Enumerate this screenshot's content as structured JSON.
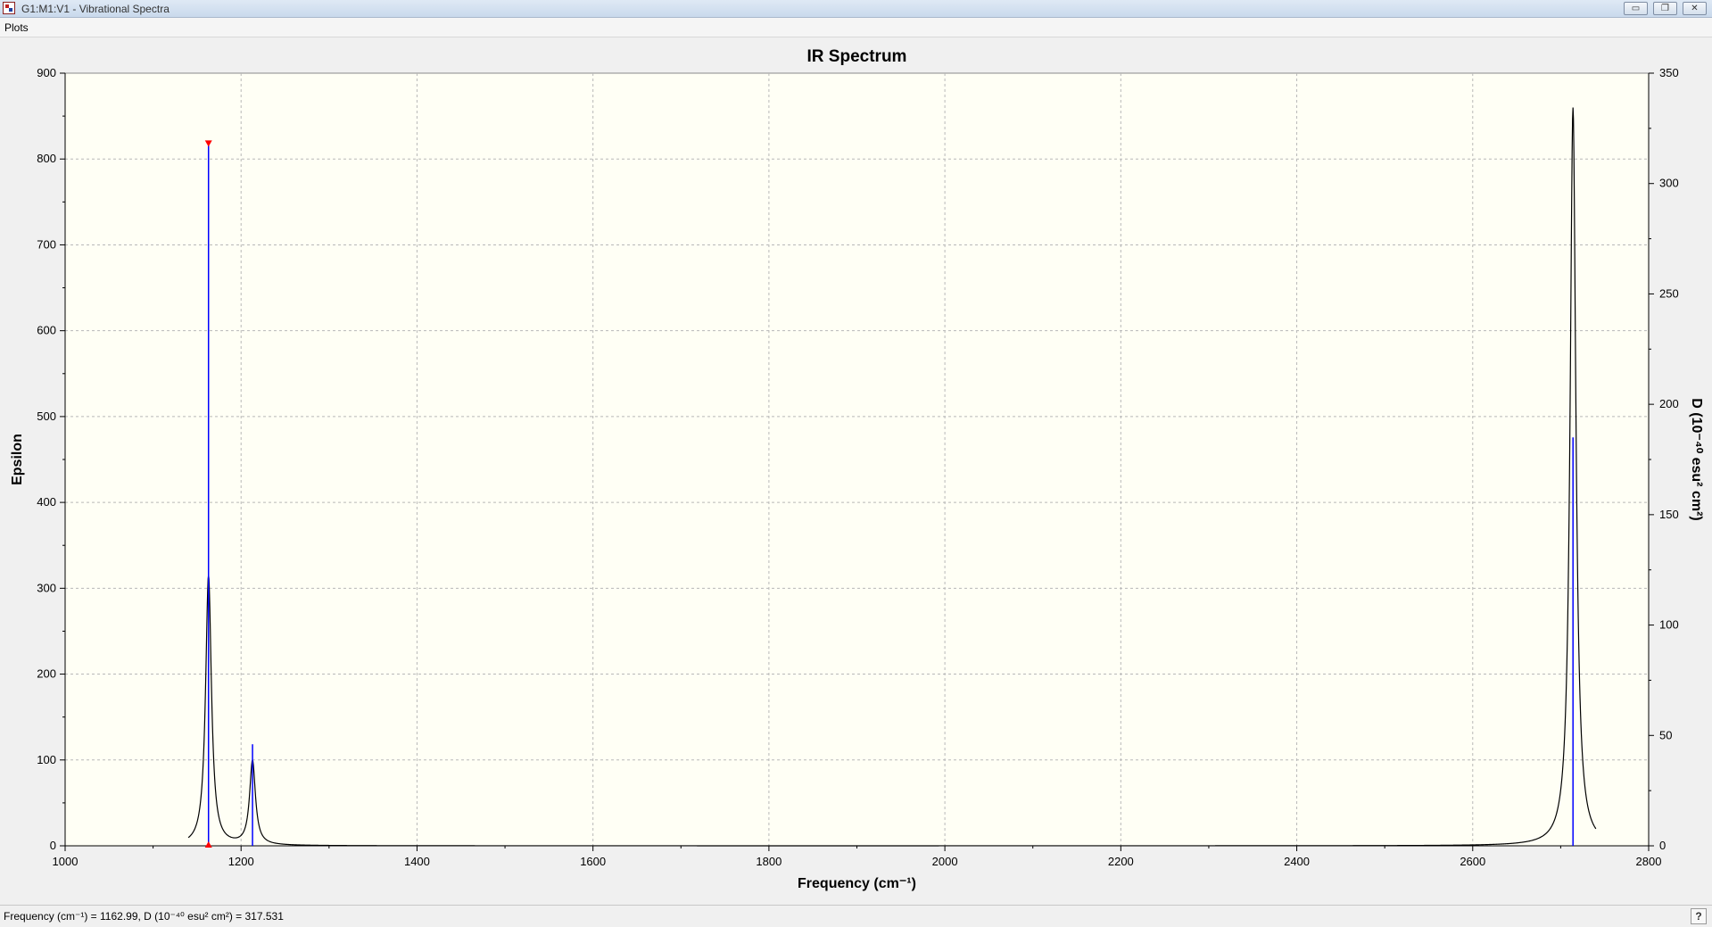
{
  "window": {
    "title": "G1:M1:V1 - Vibrational Spectra",
    "minimize_label": "▭",
    "restore_label": "❐",
    "close_label": "✕"
  },
  "menu": {
    "plots_label": "Plots"
  },
  "status": {
    "readout": "Frequency (cm⁻¹) = 1162.99, D (10⁻⁴⁰ esu² cm²) = 317.531",
    "help_label": "?"
  },
  "colors": {
    "plot_bg": "#fffff5",
    "grid": "#b8b8b8",
    "curve": "#000000",
    "stick": "#0000ff",
    "marker": "#ff0000"
  },
  "chart_data": {
    "type": "line",
    "title": "IR Spectrum",
    "xlabel": "Frequency (cm⁻¹)",
    "ylabel": "Epsilon",
    "y2label": "D (10⁻⁴⁰ esu² cm²)",
    "xlim": [
      1000,
      2800
    ],
    "ylim": [
      0,
      900
    ],
    "y2lim": [
      0,
      350
    ],
    "xticks": [
      1000,
      1200,
      1400,
      1600,
      1800,
      2000,
      2200,
      2400,
      2600,
      2800
    ],
    "yticks": [
      0,
      100,
      200,
      300,
      400,
      500,
      600,
      700,
      800,
      900
    ],
    "y2ticks": [
      0,
      50,
      100,
      150,
      200,
      250,
      300,
      350
    ],
    "grid": true,
    "spectrum_range": [
      1140,
      2740
    ],
    "peaks": [
      {
        "frequency": 1163,
        "epsilon": 315,
        "hwhm": 4
      },
      {
        "frequency": 1213,
        "epsilon": 98,
        "hwhm": 4
      },
      {
        "frequency": 2714,
        "epsilon": 860,
        "hwhm": 4
      }
    ],
    "sticks": [
      {
        "frequency": 1162.99,
        "d": 317.531
      },
      {
        "frequency": 1213,
        "d": 46
      },
      {
        "frequency": 2714,
        "d": 185
      }
    ],
    "selected_stick": {
      "frequency": 1162.99,
      "d": 317.531
    }
  }
}
